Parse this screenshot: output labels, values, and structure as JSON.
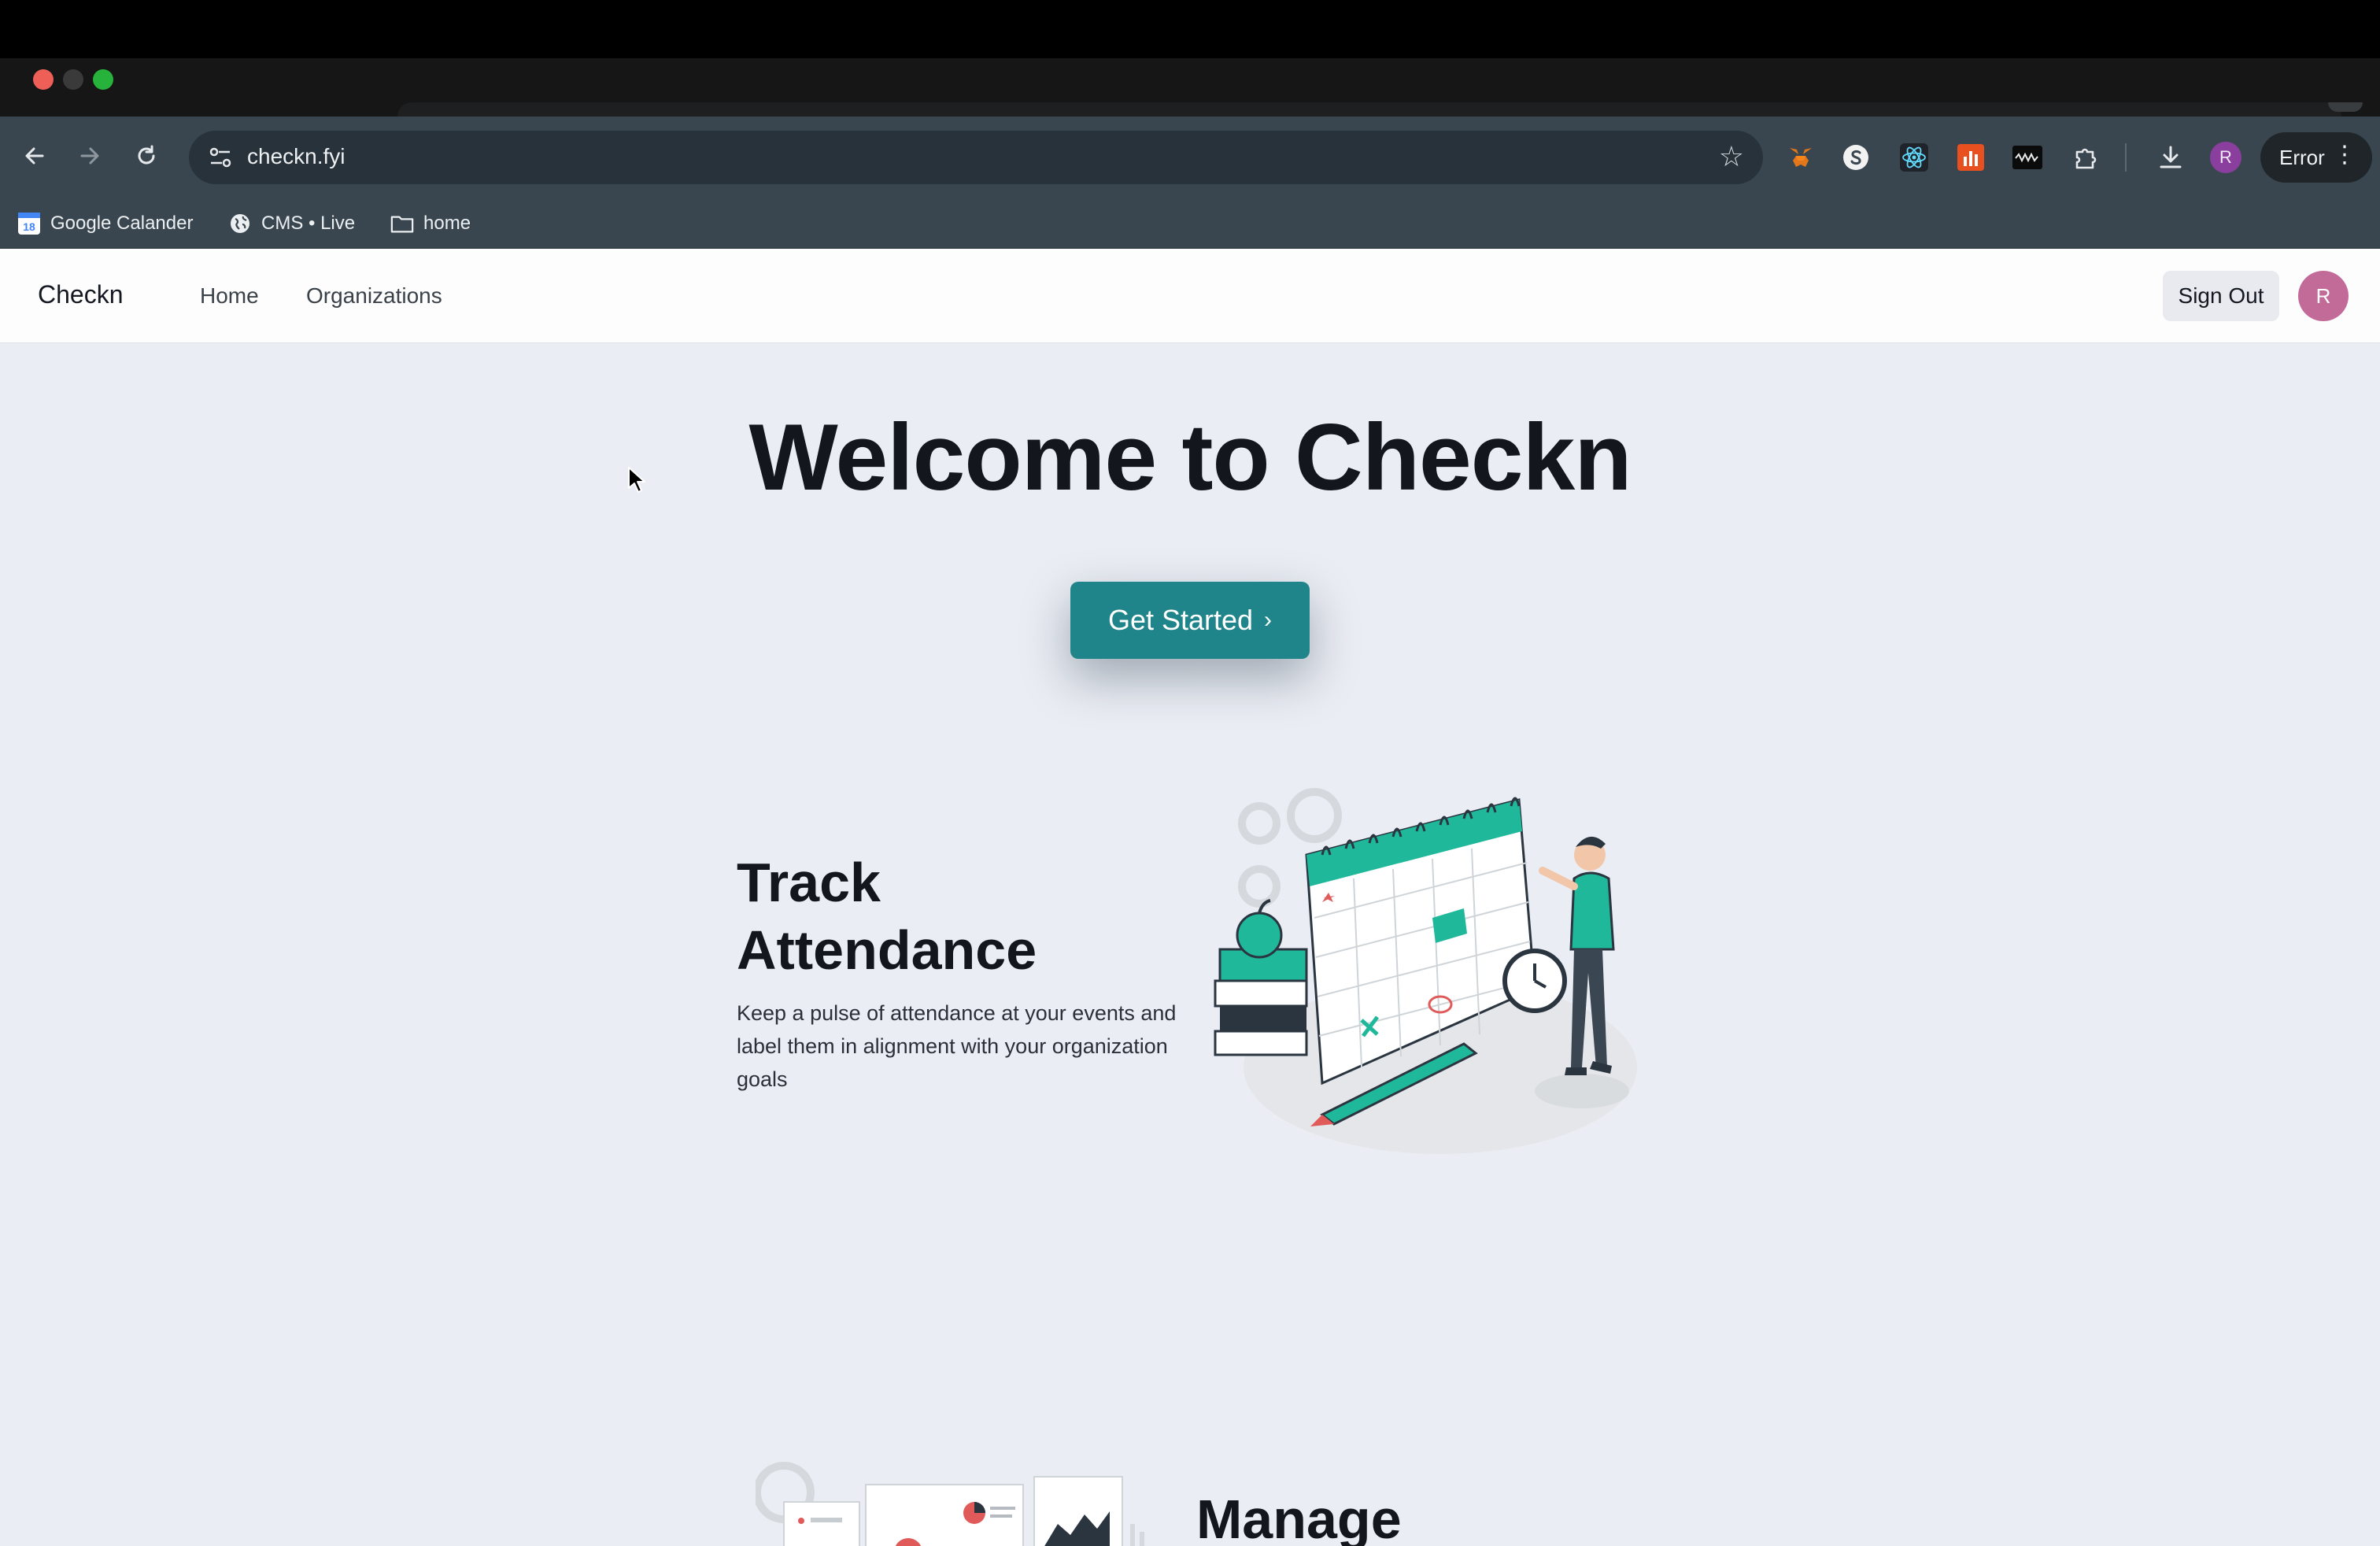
{
  "browser": {
    "url": "checkn.fyi",
    "error_label": "Error",
    "profile_initial": "R",
    "bookmarks": [
      {
        "label": "Google Calander",
        "icon": "google-calendar-icon"
      },
      {
        "label": "CMS • Live",
        "icon": "globe-icon"
      },
      {
        "label": "home",
        "icon": "folder-icon"
      }
    ],
    "calendar_badge": "18"
  },
  "site": {
    "brand": "Checkn",
    "nav": [
      "Home",
      "Organizations"
    ],
    "sign_out": "Sign Out",
    "avatar_initial": "R"
  },
  "hero": {
    "title": "Welcome to Checkn",
    "cta": "Get Started",
    "cta_chevron": "›"
  },
  "features": [
    {
      "title_line1": "Track",
      "title_line2": "Attendance",
      "description": "Keep a pulse of attendance at your events and label them in alignment with your organization goals"
    },
    {
      "title": "Manage"
    }
  ],
  "colors": {
    "accent": "#20858a",
    "page_bg": "#eaedf3",
    "avatar": "#c36b98"
  }
}
